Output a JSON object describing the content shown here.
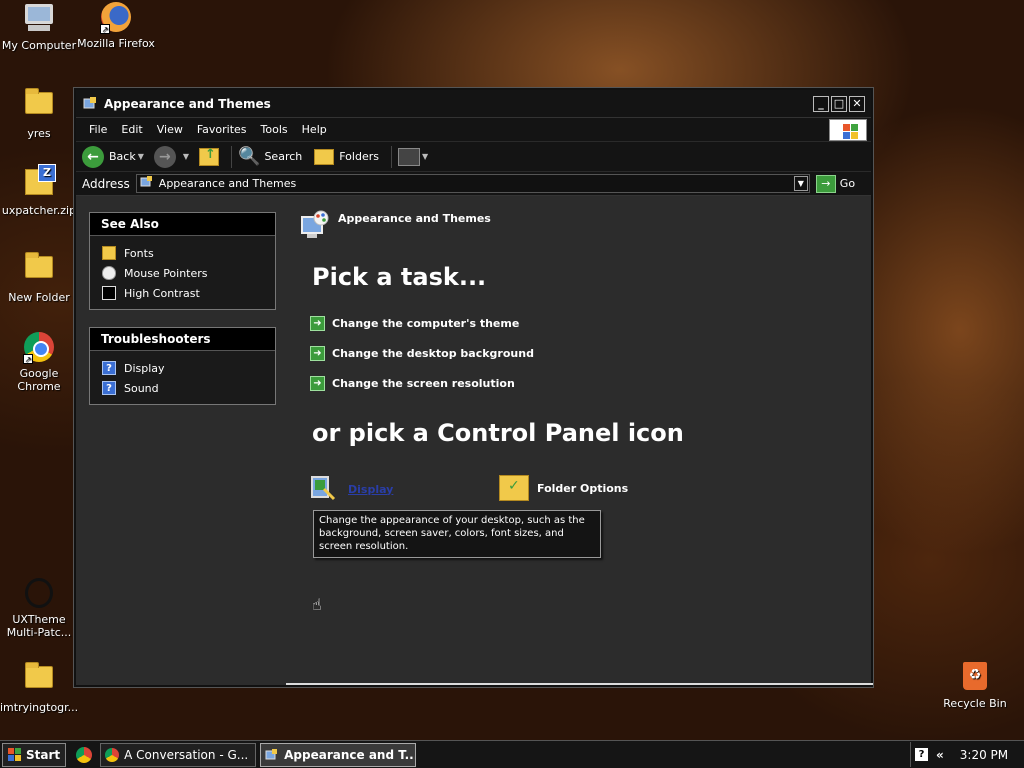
{
  "desktop": {
    "icons": [
      {
        "label": "My Computer"
      },
      {
        "label": "Mozilla Firefox"
      },
      {
        "label": "yres"
      },
      {
        "label": "uxpatcher.zip"
      },
      {
        "label": "New Folder"
      },
      {
        "label": "Google Chrome"
      },
      {
        "label": "UXTheme Multi-Patc..."
      },
      {
        "label": "imtryingtogr..."
      },
      {
        "label": "Recycle Bin"
      }
    ]
  },
  "window": {
    "title": "Appearance and Themes",
    "controls": {
      "minimize": "_",
      "maximize": "□",
      "close": "✕"
    },
    "menu": [
      "File",
      "Edit",
      "View",
      "Favorites",
      "Tools",
      "Help"
    ],
    "toolbar": {
      "back": "Back",
      "search": "Search",
      "folders": "Folders"
    },
    "address": {
      "label": "Address",
      "value": "Appearance and Themes",
      "go": "Go"
    }
  },
  "sidebar": {
    "see_also": {
      "title": "See Also",
      "items": [
        "Fonts",
        "Mouse Pointers",
        "High Contrast"
      ]
    },
    "troubleshooters": {
      "title": "Troubleshooters",
      "items": [
        "Display",
        "Sound"
      ]
    }
  },
  "main": {
    "section_title": "Appearance and Themes",
    "pick_task": "Pick a task...",
    "tasks": [
      "Change the computer's theme",
      "Change the desktop background",
      "Change the screen resolution"
    ],
    "pick_icon": "or pick a Control Panel icon",
    "icons": [
      "Display",
      "Folder Options"
    ],
    "tooltip": "Change the appearance of your desktop, such as the background, screen saver, colors, font sizes, and screen resolution."
  },
  "taskbar": {
    "start": "Start",
    "buttons": [
      "A Conversation - G...",
      "Appearance and T..."
    ],
    "clock": "3:20 PM",
    "tray_help": "?",
    "tray_chevron": "«"
  },
  "colors": {
    "accent_green": "#3c9c3c",
    "link_blue": "#2a3ea8",
    "window_bg": "#2c2c2c",
    "titlebar_bg": "#141414"
  }
}
